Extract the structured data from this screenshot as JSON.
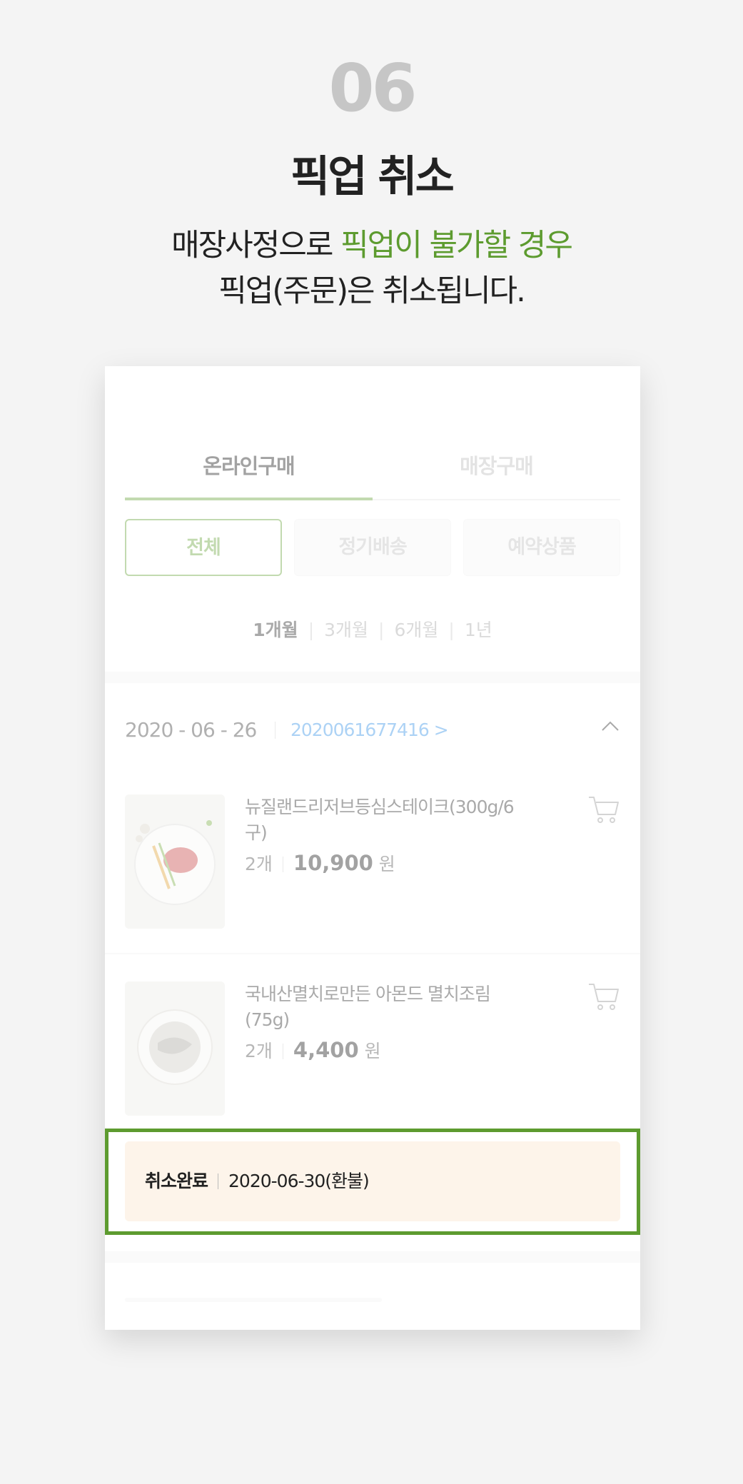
{
  "step_number": "06",
  "title": "픽업 취소",
  "description": {
    "line1_prefix": "매장사정으로 ",
    "line1_highlight": "픽업이 불가할 경우",
    "line2": "픽업(주문)은 취소됩니다."
  },
  "colors": {
    "accent_green": "#5d9b2f",
    "order_link_blue": "#3a94e6",
    "cancel_box_bg": "#fdf4ea"
  },
  "tabs": [
    {
      "label": "온라인구매",
      "active": true
    },
    {
      "label": "매장구매",
      "active": false
    }
  ],
  "filters": [
    {
      "label": "전체",
      "active": true
    },
    {
      "label": "정기배송",
      "active": false
    },
    {
      "label": "예약상품",
      "active": false
    }
  ],
  "periods": [
    {
      "label": "1개월",
      "active": true
    },
    {
      "label": "3개월",
      "active": false
    },
    {
      "label": "6개월",
      "active": false
    },
    {
      "label": "1년",
      "active": false
    }
  ],
  "order": {
    "date": "2020 - 06 - 26",
    "number": "2020061677416",
    "link_arrow": ">",
    "collapse_icon": "chevron-up-icon"
  },
  "items": [
    {
      "name": "뉴질랜드리저브등심스테이크(300g/6구)",
      "quantity": "2개",
      "price": "10,900",
      "currency": "원",
      "image": "steak-on-plate",
      "cart_icon": "cart-icon"
    },
    {
      "name": "국내산멸치로만든 아몬드 멸치조림(75g)",
      "quantity": "2개",
      "price": "4,400",
      "currency": "원",
      "image": "anchovy-bowl",
      "cart_icon": "cart-icon"
    }
  ],
  "cancel_status": {
    "label": "취소완료",
    "detail": "2020-06-30(환불)"
  }
}
